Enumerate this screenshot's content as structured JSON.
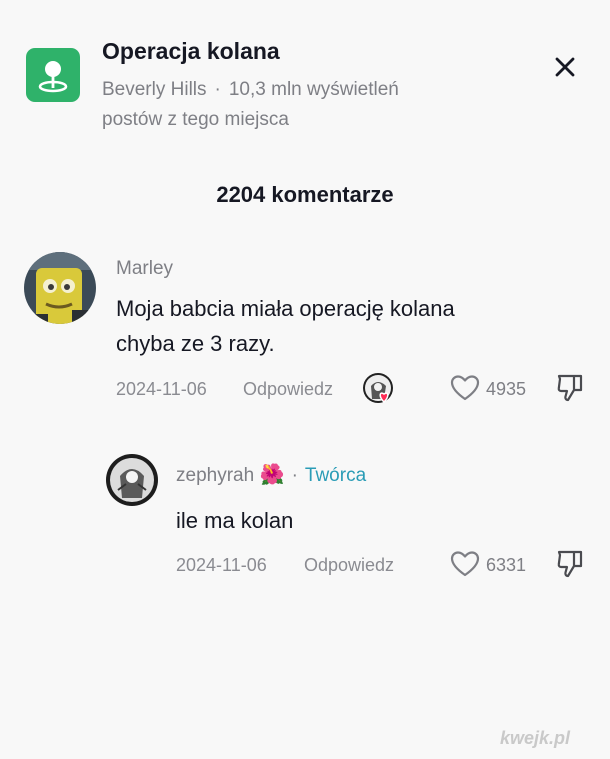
{
  "header": {
    "title": "Operacja kolana",
    "location": "Beverly Hills",
    "separator": "·",
    "views": "10,3 mln wyświetleń",
    "views_line2": "postów z tego miejsca",
    "icon": "location-pin-icon",
    "accent_color": "#2fb26a"
  },
  "comments_count": "2204 komentarze",
  "comments": [
    {
      "username": "Marley",
      "text_line1": "Moja babcia miała operację kolana",
      "text_line2": "chyba ze 3 razy.",
      "date": "2024-11-06",
      "reply_label": "Odpowiedz",
      "likes": "4935",
      "liked_by_creator": true
    }
  ],
  "reply": {
    "username": "zephyrah",
    "emoji": "🌺",
    "separator": "·",
    "badge": "Twórca",
    "text": "ile ma kolan",
    "date": "2024-11-06",
    "reply_label": "Odpowiedz",
    "likes": "6331"
  },
  "watermark": "kwejk.pl"
}
